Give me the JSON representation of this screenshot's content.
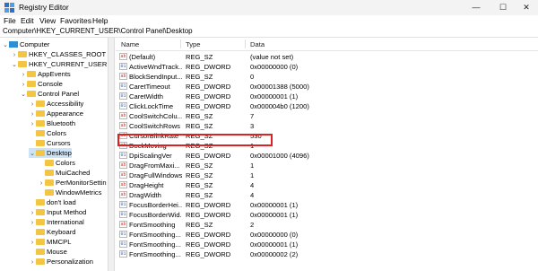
{
  "window": {
    "title": "Registry Editor",
    "minimize": "—",
    "maximize": "☐",
    "close": "✕"
  },
  "menu": [
    "File",
    "Edit",
    "View",
    "Favorites",
    "Help"
  ],
  "address": "Computer\\HKEY_CURRENT_USER\\Control Panel\\Desktop",
  "tree": [
    {
      "label": "Computer",
      "depth": 0,
      "chev": "⌄",
      "icon": "computer"
    },
    {
      "label": "HKEY_CLASSES_ROOT",
      "depth": 1,
      "chev": "›",
      "icon": "folder"
    },
    {
      "label": "HKEY_CURRENT_USER",
      "depth": 1,
      "chev": "⌄",
      "icon": "folder"
    },
    {
      "label": "AppEvents",
      "depth": 2,
      "chev": "›",
      "icon": "folder"
    },
    {
      "label": "Console",
      "depth": 2,
      "chev": "›",
      "icon": "folder"
    },
    {
      "label": "Control Panel",
      "depth": 2,
      "chev": "⌄",
      "icon": "folder"
    },
    {
      "label": "Accessibility",
      "depth": 3,
      "chev": "›",
      "icon": "folder"
    },
    {
      "label": "Appearance",
      "depth": 3,
      "chev": "›",
      "icon": "folder"
    },
    {
      "label": "Bluetooth",
      "depth": 3,
      "chev": "›",
      "icon": "folder"
    },
    {
      "label": "Colors",
      "depth": 3,
      "chev": "",
      "icon": "folder"
    },
    {
      "label": "Cursors",
      "depth": 3,
      "chev": "",
      "icon": "folder"
    },
    {
      "label": "Desktop",
      "depth": 3,
      "chev": "⌄",
      "icon": "folder",
      "selected": true
    },
    {
      "label": "Colors",
      "depth": 4,
      "chev": "",
      "icon": "folder"
    },
    {
      "label": "MuiCached",
      "depth": 4,
      "chev": "",
      "icon": "folder"
    },
    {
      "label": "PerMonitorSettin",
      "depth": 4,
      "chev": "›",
      "icon": "folder"
    },
    {
      "label": "WindowMetrics",
      "depth": 4,
      "chev": "",
      "icon": "folder"
    },
    {
      "label": "don't load",
      "depth": 3,
      "chev": "",
      "icon": "folder"
    },
    {
      "label": "Input Method",
      "depth": 3,
      "chev": "›",
      "icon": "folder"
    },
    {
      "label": "International",
      "depth": 3,
      "chev": "›",
      "icon": "folder"
    },
    {
      "label": "Keyboard",
      "depth": 3,
      "chev": "",
      "icon": "folder"
    },
    {
      "label": "MMCPL",
      "depth": 3,
      "chev": "›",
      "icon": "folder"
    },
    {
      "label": "Mouse",
      "depth": 3,
      "chev": "",
      "icon": "folder"
    },
    {
      "label": "Personalization",
      "depth": 3,
      "chev": "›",
      "icon": "folder"
    }
  ],
  "columns": {
    "name": "Name",
    "type": "Type",
    "data": "Data"
  },
  "rows": [
    {
      "name": "(Default)",
      "type": "REG_SZ",
      "data": "(value not set)",
      "kind": "sz"
    },
    {
      "name": "ActiveWndTrack...",
      "type": "REG_DWORD",
      "data": "0x00000000 (0)",
      "kind": "dw"
    },
    {
      "name": "BlockSendInput...",
      "type": "REG_SZ",
      "data": "0",
      "kind": "sz"
    },
    {
      "name": "CaretTimeout",
      "type": "REG_DWORD",
      "data": "0x00001388 (5000)",
      "kind": "dw"
    },
    {
      "name": "CaretWidth",
      "type": "REG_DWORD",
      "data": "0x00000001 (1)",
      "kind": "dw"
    },
    {
      "name": "ClickLockTime",
      "type": "REG_DWORD",
      "data": "0x000004b0 (1200)",
      "kind": "dw"
    },
    {
      "name": "CoolSwitchColu...",
      "type": "REG_SZ",
      "data": "7",
      "kind": "sz"
    },
    {
      "name": "CoolSwitchRows",
      "type": "REG_SZ",
      "data": "3",
      "kind": "sz"
    },
    {
      "name": "CursorBlinkRate",
      "type": "REG_SZ",
      "data": "530",
      "kind": "sz"
    },
    {
      "name": "DockMoving",
      "type": "REG_SZ",
      "data": "1",
      "kind": "sz"
    },
    {
      "name": "DpiScalingVer",
      "type": "REG_DWORD",
      "data": "0x00001000 (4096)",
      "kind": "dw"
    },
    {
      "name": "DragFromMaxi...",
      "type": "REG_SZ",
      "data": "1",
      "kind": "sz"
    },
    {
      "name": "DragFullWindows",
      "type": "REG_SZ",
      "data": "1",
      "kind": "sz"
    },
    {
      "name": "DragHeight",
      "type": "REG_SZ",
      "data": "4",
      "kind": "sz"
    },
    {
      "name": "DragWidth",
      "type": "REG_SZ",
      "data": "4",
      "kind": "sz"
    },
    {
      "name": "FocusBorderHei...",
      "type": "REG_DWORD",
      "data": "0x00000001 (1)",
      "kind": "dw"
    },
    {
      "name": "FocusBorderWid...",
      "type": "REG_DWORD",
      "data": "0x00000001 (1)",
      "kind": "dw"
    },
    {
      "name": "FontSmoothing",
      "type": "REG_SZ",
      "data": "2",
      "kind": "sz"
    },
    {
      "name": "FontSmoothing...",
      "type": "REG_DWORD",
      "data": "0x00000000 (0)",
      "kind": "dw"
    },
    {
      "name": "FontSmoothing...",
      "type": "REG_DWORD",
      "data": "0x00000001 (1)",
      "kind": "dw"
    },
    {
      "name": "FontSmoothing...",
      "type": "REG_DWORD",
      "data": "0x00000002 (2)",
      "kind": "dw"
    }
  ],
  "icons": {
    "sz": "ab",
    "dw": "01"
  },
  "highlight_row": "CursorBlinkRate",
  "colors": {
    "selection": "#cce4f7",
    "highlight_border": "#dd2222",
    "folder": "#f4c542"
  }
}
